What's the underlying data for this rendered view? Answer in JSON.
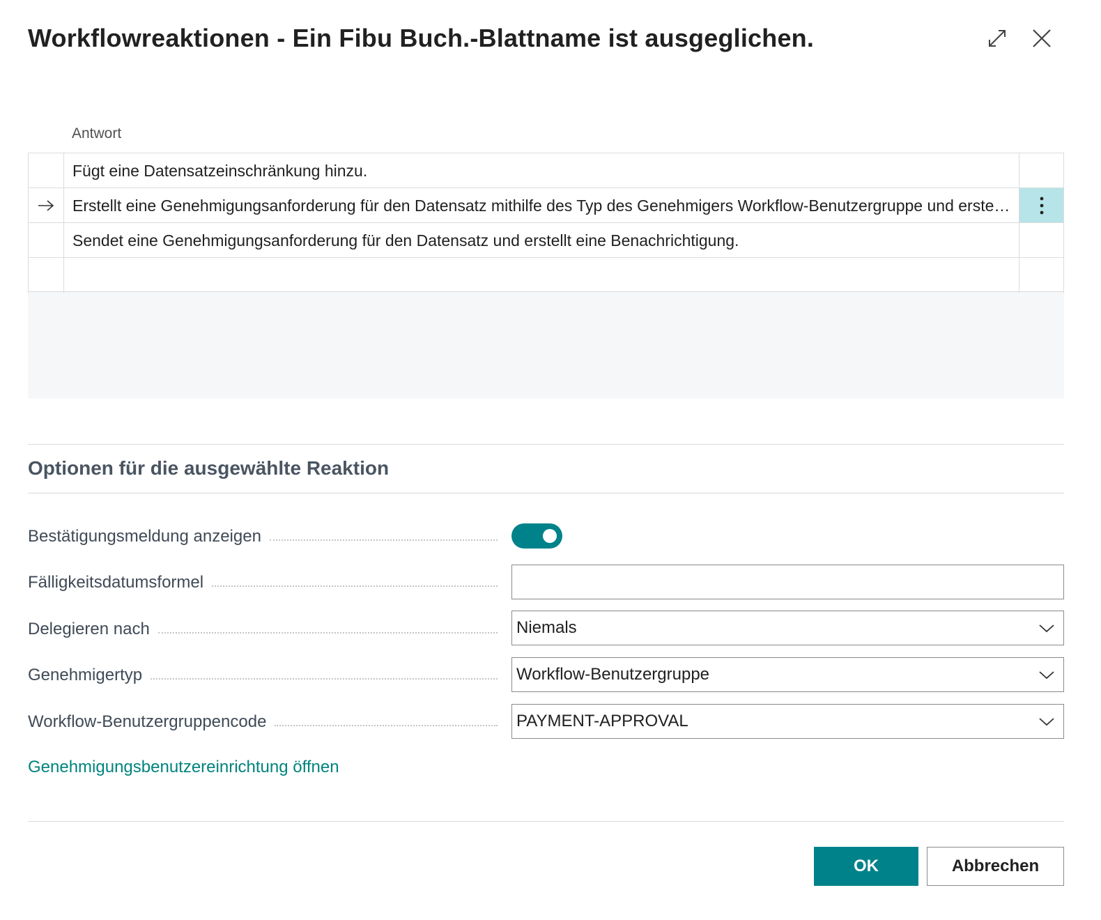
{
  "dialog": {
    "title": "Workflowreaktionen - Ein Fibu Buch.-Blattname ist ausgeglichen."
  },
  "grid": {
    "column_header": "Antwort",
    "rows": [
      {
        "text": "Fügt eine Datensatzeinschränkung hinzu.",
        "selected": false
      },
      {
        "text": "Erstellt eine Genehmigungsanforderung für den Datensatz mithilfe des Typ des Genehmigers Workflow-Benutzergruppe und erstellt eine Benachrichtigung.",
        "selected": true
      },
      {
        "text": "Sendet eine Genehmigungsanforderung für den Datensatz und erstellt eine Benachrichtigung.",
        "selected": false
      },
      {
        "text": "",
        "selected": false
      }
    ]
  },
  "options": {
    "section_title": "Optionen für die ausgewählte Reaktion",
    "confirm_message_label": "Bestätigungsmeldung anzeigen",
    "confirm_message_enabled": true,
    "due_date_formula_label": "Fälligkeitsdatumsformel",
    "due_date_formula_value": "",
    "delegate_after_label": "Delegieren nach",
    "delegate_after_value": "Niemals",
    "approver_type_label": "Genehmigertyp",
    "approver_type_value": "Workflow-Benutzergruppe",
    "user_group_code_label": "Workflow-Benutzergruppencode",
    "user_group_code_value": "PAYMENT-APPROVAL",
    "open_setup_link": "Genehmigungsbenutzereinrichtung öffnen"
  },
  "footer": {
    "ok_label": "OK",
    "cancel_label": "Abbrechen"
  },
  "colors": {
    "accent": "#00828a",
    "selected_cell": "#b6e4e8",
    "link": "#00837e"
  },
  "icons": {
    "expand": "expand-icon",
    "close": "close-icon",
    "row_pointer": "arrow-right-icon",
    "row_actions": "more-vertical-icon",
    "dropdown": "chevron-down-icon"
  }
}
